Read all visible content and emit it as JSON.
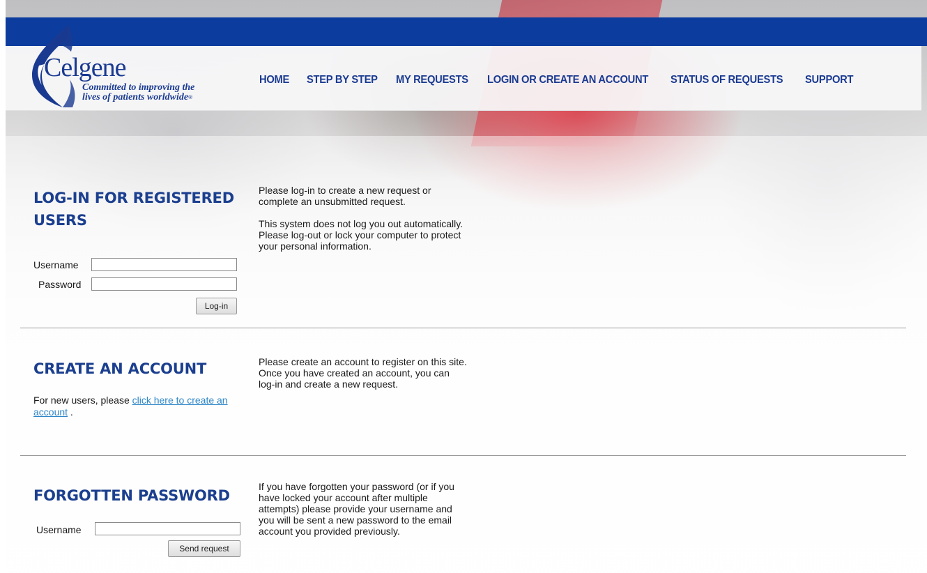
{
  "brand": {
    "name": "Celgene",
    "tagline_line1": "Committed to improving the",
    "tagline_line2": "lives of patients worldwide",
    "tagline_mark": "®",
    "color": "#1a3a91"
  },
  "nav": {
    "items": [
      {
        "label": "HOME"
      },
      {
        "label": "STEP BY STEP"
      },
      {
        "label": "MY REQUESTS"
      },
      {
        "label": "LOGIN OR CREATE AN ACCOUNT"
      },
      {
        "label": "STATUS OF REQUESTS"
      },
      {
        "label": "SUPPORT"
      }
    ]
  },
  "login": {
    "title_line1": "LOG-IN FOR REGISTERED",
    "title_line2": "USERS",
    "username_label": "Username",
    "username_value": "",
    "password_label": "Password",
    "password_value": "",
    "submit_label": "Log-in",
    "description_p1": "Please log-in to create a new request or complete an unsubmitted request.",
    "description_p2": "This system does not log you out automatically. Please log-out or lock your computer to protect your personal information."
  },
  "create_account": {
    "title": "CREATE AN ACCOUNT",
    "prompt_prefix": "For new users, please ",
    "link_text": "click here to create an account",
    "prompt_suffix": " .",
    "description": "Please create an account to register on this site. Once you have created an account, you can log-in and create a new request."
  },
  "forgotten_password": {
    "title": "FORGOTTEN PASSWORD",
    "username_label": "Username",
    "username_value": "",
    "submit_label": "Send request",
    "description": "If you have forgotten your password (or if you have locked your account after multiple attempts) please provide your username and you will be sent a new password to the email account you provided previously."
  },
  "colors": {
    "top_bar": "#0c3d9e",
    "heading": "#1b3f8f",
    "link": "#2e86c8"
  }
}
